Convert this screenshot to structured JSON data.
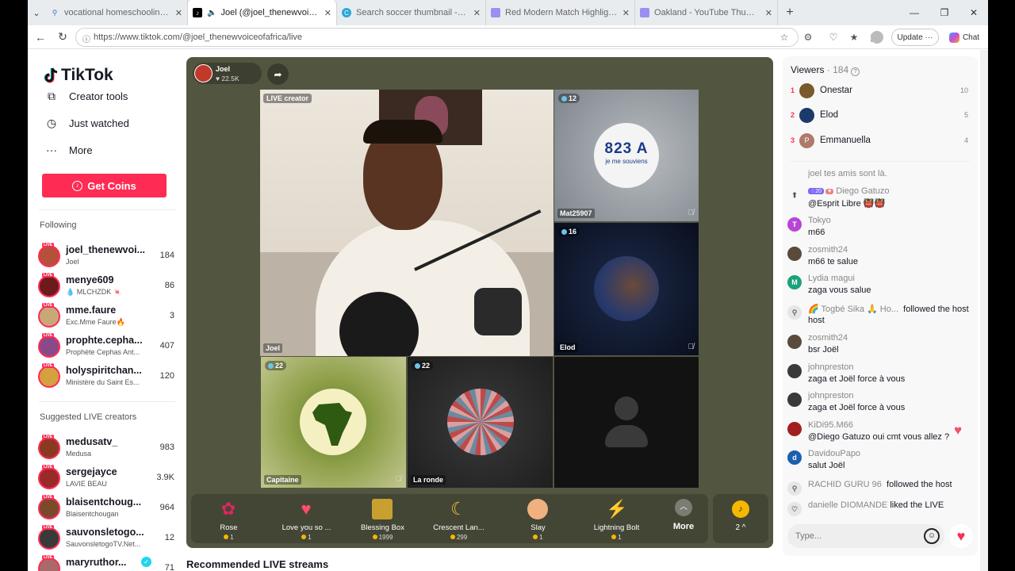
{
  "browser": {
    "tabs": [
      {
        "title": "vocational homeschooling - Search",
        "fav_color": "#ffffff",
        "fav_text": "🔍"
      },
      {
        "title": "Joel (@joel_thenewvoiceofafrica)",
        "fav_color": "#000000",
        "fav_text": "♪"
      },
      {
        "title": "Search soccer thumbnail - Canva",
        "fav_color": "#2ba7d8",
        "fav_text": "C"
      },
      {
        "title": "Red Modern Match Highlight YouTube",
        "fav_color": "#9b8ff2",
        "fav_text": "▭"
      },
      {
        "title": "Oakland - YouTube Thumbnail",
        "fav_color": "#9b8ff2",
        "fav_text": "▭"
      }
    ],
    "url": "https://www.tiktok.com/@joel_thenewvoiceofafrica/live",
    "update_label": "Update",
    "chat_label": "Chat"
  },
  "sidebar": {
    "logo": "TikTok",
    "links": [
      {
        "label": "Creator tools",
        "icon": "creator-tools-icon"
      },
      {
        "label": "Just watched",
        "icon": "history-icon"
      },
      {
        "label": "More",
        "icon": "more-icon"
      }
    ],
    "get_coins": "Get Coins",
    "following_header": "Following",
    "following": [
      {
        "name": "joel_thenewvoi...",
        "sub": "Joel",
        "count": "184",
        "color": "#b5503a"
      },
      {
        "name": "menye609",
        "sub": "💧 MLCHZDK 🍬",
        "count": "86",
        "color": "#6b1b1b"
      },
      {
        "name": "mme.faure",
        "sub": "Exc.Mme Faure🔥",
        "count": "3",
        "color": "#c8a878"
      },
      {
        "name": "prophte.cepha...",
        "sub": "Prophète Cephas Ant...",
        "count": "407",
        "color": "#8a4a8a"
      },
      {
        "name": "holyspiritchan...",
        "sub": "Ministère du Saint Es...",
        "count": "120",
        "color": "#d4a040"
      }
    ],
    "suggested_header": "Suggested LIVE creators",
    "suggested": [
      {
        "name": "medusatv_",
        "sub": "Medusa",
        "count": "983",
        "color": "#8a3a20"
      },
      {
        "name": "sergejayce",
        "sub": "LAVIE BEAU",
        "count": "3.9K",
        "color": "#9a2a2a"
      },
      {
        "name": "blaisentchoug...",
        "sub": "Blaisentchougan",
        "count": "964",
        "color": "#7a4a2a"
      },
      {
        "name": "sauvonsletogo...",
        "sub": "SauvonsletogoTV.Net...",
        "count": "12",
        "color": "#3a3a3a"
      },
      {
        "name": "maryruthor...",
        "sub": "",
        "count": "71",
        "color": "#aa6a6a"
      }
    ]
  },
  "stage": {
    "host_name": "Joel",
    "host_likes": "♥ 22.5K",
    "creator_tag": "LIVE creator",
    "cells": [
      {
        "label": "Joel",
        "badge": ""
      },
      {
        "label": "Mat25907",
        "badge": "12"
      },
      {
        "label": "Elod",
        "badge": "16"
      },
      {
        "label": "Capitaine",
        "badge": "22"
      },
      {
        "label": "La ronde",
        "badge": "22"
      }
    ],
    "plate_text": "823 A",
    "plate_sub": "je me souviens",
    "gifts": [
      {
        "name": "Rose",
        "price": "1",
        "icon": "rose-icon"
      },
      {
        "name": "Love you so ...",
        "price": "1",
        "icon": "love-you-icon"
      },
      {
        "name": "Blessing Box",
        "price": "1999",
        "icon": "blessing-box-icon"
      },
      {
        "name": "Crescent Lan...",
        "price": "299",
        "icon": "crescent-lantern-icon"
      },
      {
        "name": "Slay",
        "price": "1",
        "icon": "slay-icon"
      },
      {
        "name": "Lightning Bolt",
        "price": "1",
        "icon": "lightning-bolt-icon"
      }
    ],
    "more_label": "More",
    "coin_count": "2 ^"
  },
  "recommended_header": "Recommended LIVE streams",
  "viewers": {
    "title": "Viewers",
    "count": " · 184",
    "list": [
      {
        "rank": "1",
        "name": "Onestar",
        "score": "10",
        "color": "#7a5a2a"
      },
      {
        "rank": "2",
        "name": "Elod",
        "score": "5",
        "color": "#1a3a6a"
      },
      {
        "rank": "3",
        "name": "Emmanuella",
        "score": "4",
        "color": "#b07a6a"
      }
    ]
  },
  "chat": {
    "messages": [
      {
        "type": "text",
        "user": "",
        "text": "joel tes amis sont là.",
        "avatar": "",
        "color": "#ffffff"
      },
      {
        "type": "msg",
        "user": "Diego Gatuzo",
        "lvl": "20",
        "text": "@Esprit Libre 👹👹",
        "avatar": "",
        "color": "#555555"
      },
      {
        "type": "msg",
        "user": "Tokyo",
        "text": "m66",
        "avatar": "T",
        "color": "#b845d6"
      },
      {
        "type": "msg",
        "user": "zosmith24",
        "text": "m66 te salue",
        "avatar": "",
        "color": "#5a4a3a"
      },
      {
        "type": "msg",
        "user": "Lydia magui",
        "text": "zaga vous salue",
        "avatar": "M",
        "color": "#1ba27a"
      },
      {
        "type": "follow",
        "user": "🌈 Togbé Sika 🙏 Ho...",
        "text": "followed the host",
        "avatar": "",
        "color": "#e6e6e6"
      },
      {
        "type": "msg",
        "user": "zosmith24",
        "text": "bsr Joël",
        "avatar": "",
        "color": "#5a4a3a"
      },
      {
        "type": "msg",
        "user": "johnpreston",
        "text": "zaga et Joël force à vous",
        "avatar": "",
        "color": "#3a3a3a"
      },
      {
        "type": "msg",
        "user": "johnpreston",
        "text": "zaga et Joël force à vous",
        "avatar": "",
        "color": "#3a3a3a"
      },
      {
        "type": "msg",
        "user": "KiDi95.M66",
        "text": "@Diego Gatuzo oui cmt vous allez ?",
        "avatar": "",
        "color": "#a02020"
      },
      {
        "type": "msg",
        "user": "DavidouPapo",
        "text": "salut Joël",
        "avatar": "d",
        "color": "#1b5fb0"
      },
      {
        "type": "follow",
        "user": "RACHID GURU 96",
        "text": "followed the host",
        "avatar": "",
        "color": "#e6e6e6"
      },
      {
        "type": "like",
        "user": "danielle DIOMANDE",
        "text": "liked the LIVE",
        "avatar": "",
        "color": "#e6e6e6"
      }
    ],
    "placeholder": "Type..."
  }
}
